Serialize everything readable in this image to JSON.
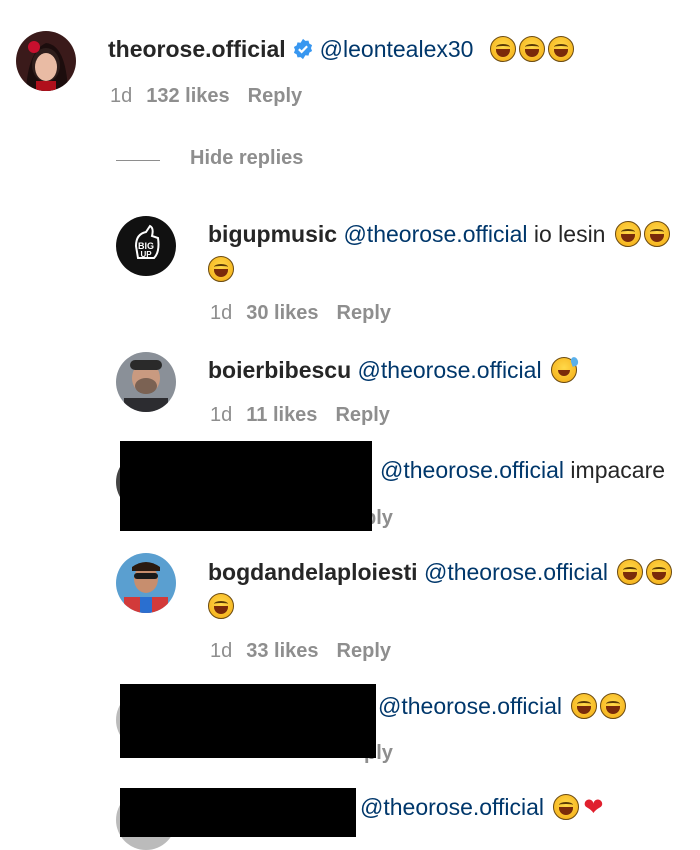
{
  "comments": [
    {
      "username": "theorose.official",
      "verified": true,
      "mention": "@leontealex30",
      "text": "",
      "age": "1d",
      "likes": "132 likes",
      "reply": "Reply"
    }
  ],
  "hide_replies_label": "Hide replies",
  "replies": [
    {
      "username": "bigupmusic",
      "mention": "@theorose.official",
      "text": "io lesin",
      "age": "1d",
      "likes": "30 likes",
      "reply": "Reply"
    },
    {
      "username": "boierbibescu",
      "mention": "@theorose.official",
      "text": "",
      "age": "1d",
      "likes": "11 likes",
      "reply": "Reply"
    },
    {
      "username": "",
      "mention": "@theorose.official",
      "text": "impacare",
      "reply_partial": "ply"
    },
    {
      "username": "bogdandelaploiesti",
      "mention": "@theorose.official",
      "text": "",
      "age": "1d",
      "likes": "33 likes",
      "reply": "Reply"
    },
    {
      "username": "",
      "mention": "@theorose.official",
      "text": "",
      "reply_partial": "ply"
    },
    {
      "username": "",
      "mention": "@theorose.official",
      "text": ""
    }
  ],
  "avatar_badge_text": "BIG UP",
  "colors": {
    "mention": "#00376b",
    "meta": "#8e8e8e",
    "verified": "#3897f0",
    "heart": "#e0202e"
  }
}
